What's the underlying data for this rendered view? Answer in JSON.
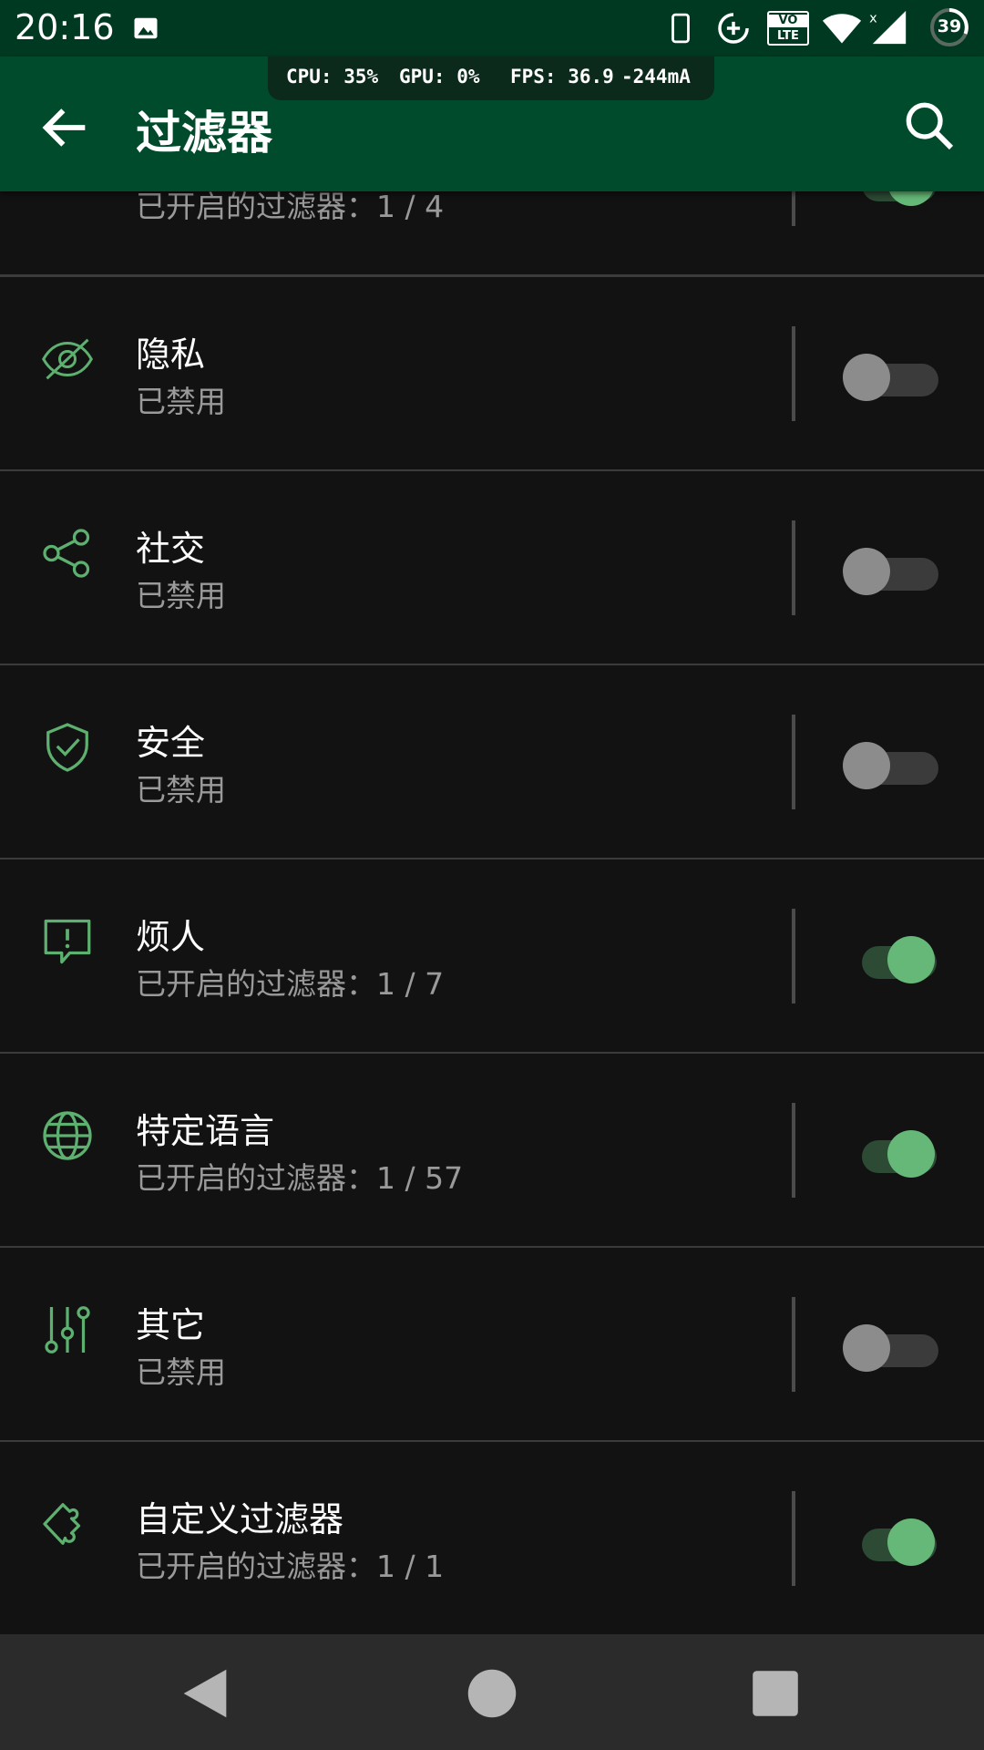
{
  "status_bar": {
    "time": "20:16",
    "icons": [
      "image-icon",
      "phone-icon",
      "data-saver-icon",
      "volte-icon",
      "wifi-icon",
      "signal-icon",
      "battery-icon"
    ],
    "volte_top": "VO",
    "volte_bottom": "LTE",
    "battery_level": "39"
  },
  "perf_overlay": {
    "cpu": "CPU: 35%",
    "gpu": "GPU: 0%",
    "fps": "FPS: 36.9",
    "current": "-244mA"
  },
  "app_bar": {
    "title": "过滤器",
    "back_icon": "arrow-back-icon",
    "search_icon": "search-icon"
  },
  "colors": {
    "app_bar": "#004b2b",
    "status_bar": "#003921",
    "accent_green": "#66b878",
    "icon_green": "#5db06f",
    "background": "#121212"
  },
  "filters": [
    {
      "title": "",
      "subtitle": "已开启的过滤器：1 / 4",
      "enabled": true,
      "icon": "partial-row-icon"
    },
    {
      "title": "隐私",
      "subtitle": "已禁用",
      "enabled": false,
      "icon": "eye-off-icon"
    },
    {
      "title": "社交",
      "subtitle": "已禁用",
      "enabled": false,
      "icon": "share-icon"
    },
    {
      "title": "安全",
      "subtitle": "已禁用",
      "enabled": false,
      "icon": "shield-check-icon"
    },
    {
      "title": "烦人",
      "subtitle": "已开启的过滤器：1 / 7",
      "enabled": true,
      "icon": "alert-message-icon"
    },
    {
      "title": "特定语言",
      "subtitle": "已开启的过滤器：1 / 57",
      "enabled": true,
      "icon": "globe-icon"
    },
    {
      "title": "其它",
      "subtitle": "已禁用",
      "enabled": false,
      "icon": "sliders-icon"
    },
    {
      "title": "自定义过滤器",
      "subtitle": "已开启的过滤器：1 / 1",
      "enabled": true,
      "icon": "puzzle-icon"
    }
  ],
  "nav_bar": {
    "back": "nav-back-icon",
    "home": "nav-home-icon",
    "recents": "nav-recents-icon"
  }
}
